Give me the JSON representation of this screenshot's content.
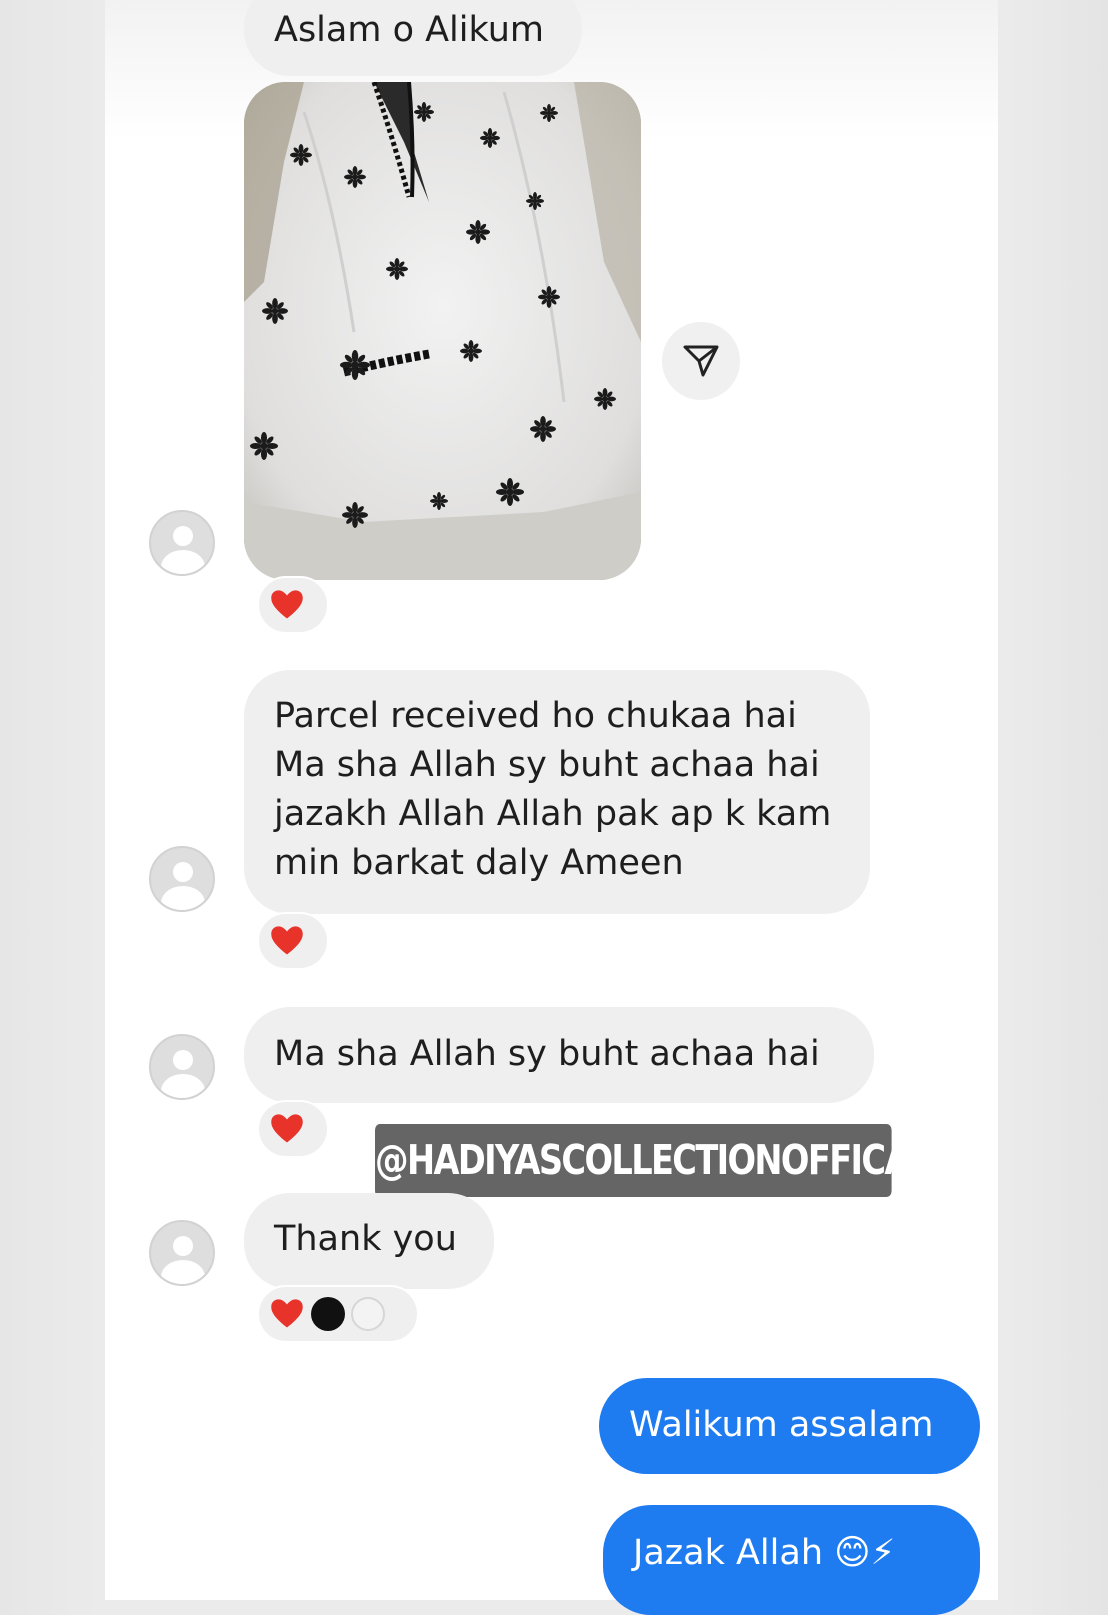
{
  "messages": {
    "m1": "Aslam o Alikum",
    "m2": "Parcel received ho chukaa hai Ma sha Allah sy buht achaa hai jazakh Allah Allah pak ap k kam min barkat daly Ameen",
    "m3": "Ma sha Allah sy buht achaa hai",
    "m4": "Thank you",
    "m5": "Walikum assalam",
    "m6": "Jazak Allah 😊⚡"
  },
  "reaction_emoji": "❤️",
  "watermark": "@HADIYASCOLLECTIONOFFICAL",
  "colors": {
    "incoming_bubble": "#efefef",
    "outgoing_bubble": "#1f7cf0",
    "heart": "#e8332b"
  },
  "icons": {
    "share": "paper-plane-icon",
    "avatar": "default-avatar-icon",
    "reaction": "heart-icon"
  }
}
